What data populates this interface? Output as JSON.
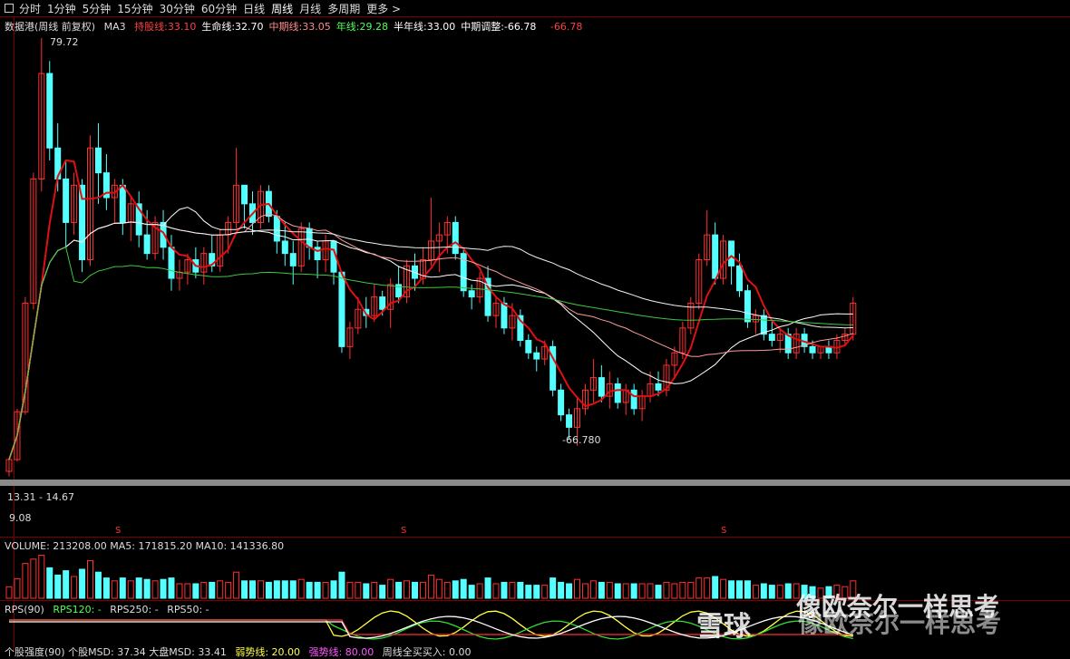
{
  "toolbar": {
    "periods": [
      "分时",
      "1分钟",
      "5分钟",
      "15分钟",
      "30分钟",
      "60分钟",
      "日线",
      "周线",
      "月线",
      "多周期",
      "更多 >"
    ],
    "active_period": "周线"
  },
  "main": {
    "stock": "数据港(周线 前复权)",
    "indicator": "MA3",
    "lines": [
      {
        "name": "持股线:",
        "value": "33.10",
        "color": "#ff4040"
      },
      {
        "name": "生命线:",
        "value": "32.70",
        "color": "#ffffff"
      },
      {
        "name": "中期线:",
        "value": "33.05",
        "color": "#ff8a8a"
      },
      {
        "name": "年线:",
        "value": "29.28",
        "color": "#55ff55"
      },
      {
        "name": "半年线:",
        "value": "33.00",
        "color": "#ffffff"
      },
      {
        "name": "中期调整:",
        "value": "-66.78",
        "color": "#ffffff"
      }
    ],
    "extra_value": "-66.78",
    "max_label": "79.72",
    "min_label": "-66.780",
    "range_label": "13.31 - 14.67",
    "low_label": "9.08"
  },
  "volume": {
    "label": "VOLUME: 213208.00",
    "ma5": "MA5: 171815.20",
    "ma10": "MA10: 141336.80"
  },
  "rps": {
    "name": "RPS(90)",
    "rps120": "RPS120: -",
    "rps250": "RPS250: -",
    "rps50": "RPS50: -"
  },
  "bottom": {
    "text": "个股强度(90)  个股MSD: 37.34  大盘MSD: 33.41",
    "weak": "弱势线: 20.00",
    "strong": "强势线: 80.00",
    "week": "周线全买买入: 0.00"
  },
  "watermarks": [
    "像欧奈尔一样思考",
    "雪球",
    "像欧奈尔一样思考"
  ],
  "colors": {
    "up": "#ff3030",
    "down": "#54ffff",
    "axis": "#7a0000",
    "ma_red": "#e01010",
    "year": "#3ec83e"
  },
  "chart_data": {
    "type": "candlestick",
    "candles": [
      [
        9.9,
        12.0,
        9.1,
        11.8
      ],
      [
        11.8,
        20,
        11.5,
        19.5
      ],
      [
        19.5,
        38,
        19,
        37
      ],
      [
        37,
        58,
        36,
        57
      ],
      [
        57,
        79.7,
        55,
        74
      ],
      [
        74,
        76,
        60,
        62
      ],
      [
        62,
        66,
        55,
        57
      ],
      [
        57,
        60,
        46,
        50
      ],
      [
        50,
        58,
        48,
        56
      ],
      [
        56,
        57,
        42,
        44
      ],
      [
        44,
        64,
        43,
        62
      ],
      [
        62,
        66,
        53,
        58
      ],
      [
        58,
        61,
        52,
        54
      ],
      [
        54,
        57,
        50,
        56
      ],
      [
        56,
        57,
        48,
        50
      ],
      [
        50,
        54,
        47,
        53
      ],
      [
        53,
        55,
        46,
        48
      ],
      [
        48,
        52,
        44,
        45
      ],
      [
        45,
        51,
        44,
        50
      ],
      [
        50,
        52,
        44,
        46
      ],
      [
        46,
        48,
        39,
        41
      ],
      [
        41,
        44,
        39,
        42
      ],
      [
        42,
        45,
        40,
        44
      ],
      [
        44,
        46,
        41,
        42
      ],
      [
        42,
        46,
        40,
        45
      ],
      [
        45,
        48,
        42,
        43
      ],
      [
        43,
        49,
        42,
        48
      ],
      [
        48,
        51,
        45,
        50
      ],
      [
        50,
        62,
        49,
        56
      ],
      [
        56,
        56,
        49,
        53
      ],
      [
        53,
        55,
        48,
        50
      ],
      [
        50,
        56,
        49,
        55
      ],
      [
        55,
        56,
        50,
        51
      ],
      [
        51,
        52,
        45,
        47
      ],
      [
        47,
        50,
        43,
        45
      ],
      [
        45,
        47,
        40,
        43
      ],
      [
        43,
        50,
        42,
        49
      ],
      [
        49,
        50,
        44,
        46
      ],
      [
        46,
        47,
        41,
        44
      ],
      [
        44,
        48,
        42,
        47
      ],
      [
        47,
        47,
        40,
        42
      ],
      [
        42,
        42,
        29,
        30
      ],
      [
        30,
        34,
        28,
        33
      ],
      [
        33,
        38,
        32,
        36
      ],
      [
        36,
        38,
        33,
        35
      ],
      [
        35,
        40,
        34,
        38
      ],
      [
        38,
        39,
        35,
        36
      ],
      [
        36,
        41,
        33,
        40
      ],
      [
        40,
        43,
        37,
        38
      ],
      [
        38,
        44,
        37,
        43
      ],
      [
        43,
        45,
        39,
        41
      ],
      [
        41,
        46,
        40,
        44
      ],
      [
        44,
        54,
        43,
        47
      ],
      [
        47,
        50,
        42,
        48
      ],
      [
        48,
        51,
        45,
        50
      ],
      [
        50,
        51,
        44,
        45
      ],
      [
        45,
        46,
        38,
        39
      ],
      [
        39,
        40,
        36,
        38
      ],
      [
        38,
        42,
        37,
        41
      ],
      [
        41,
        43,
        34,
        35
      ],
      [
        35,
        38,
        33,
        37
      ],
      [
        37,
        38,
        32,
        33
      ],
      [
        33,
        37,
        31,
        35
      ],
      [
        35,
        36,
        30,
        31
      ],
      [
        31,
        32,
        28,
        29
      ],
      [
        29,
        30,
        26,
        28
      ],
      [
        28,
        31,
        27,
        30
      ],
      [
        30,
        31,
        22,
        23
      ],
      [
        23,
        24,
        18,
        19
      ],
      [
        19,
        20,
        15,
        17
      ],
      [
        17,
        22,
        14,
        20
      ],
      [
        20,
        24,
        19,
        23
      ],
      [
        23,
        28,
        21,
        25
      ],
      [
        25,
        27,
        21,
        22
      ],
      [
        22,
        26,
        20,
        24
      ],
      [
        24,
        25,
        20,
        21
      ],
      [
        21,
        24,
        19,
        23
      ],
      [
        23,
        24,
        19,
        20
      ],
      [
        20,
        23,
        18,
        22
      ],
      [
        22,
        26,
        21,
        24
      ],
      [
        24,
        26,
        22,
        23
      ],
      [
        23,
        28,
        22,
        27
      ],
      [
        27,
        30,
        25,
        29
      ],
      [
        29,
        34,
        28,
        33
      ],
      [
        33,
        38,
        32,
        37
      ],
      [
        37,
        45,
        36,
        44
      ],
      [
        44,
        52,
        43,
        48
      ],
      [
        48,
        50,
        40,
        41
      ],
      [
        41,
        48,
        40,
        47
      ],
      [
        47,
        47,
        40,
        43
      ],
      [
        43,
        45,
        38,
        39
      ],
      [
        39,
        40,
        33,
        34
      ],
      [
        34,
        36,
        32,
        35
      ],
      [
        35,
        36,
        31,
        32
      ],
      [
        32,
        34,
        30,
        31
      ],
      [
        31,
        33,
        29,
        32
      ],
      [
        32,
        33,
        28,
        29
      ],
      [
        29,
        33,
        28,
        32
      ],
      [
        32,
        33,
        29,
        30
      ],
      [
        30,
        31,
        28,
        29
      ],
      [
        29,
        30,
        28,
        30
      ],
      [
        30,
        31,
        28,
        29
      ],
      [
        29,
        32,
        28,
        31
      ],
      [
        31,
        33,
        30,
        32
      ],
      [
        32,
        38,
        31,
        37
      ]
    ]
  }
}
